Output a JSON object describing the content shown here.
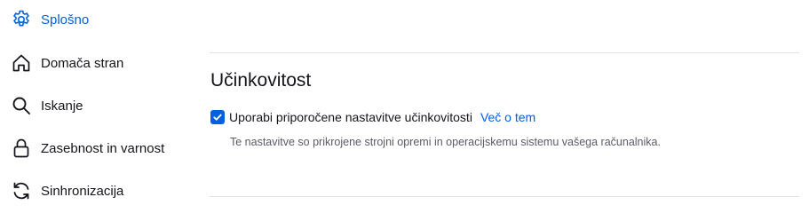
{
  "sidebar": {
    "items": [
      {
        "label": "Splošno",
        "icon": "gear-icon",
        "active": true
      },
      {
        "label": "Domača stran",
        "icon": "home-icon",
        "active": false
      },
      {
        "label": "Iskanje",
        "icon": "search-icon",
        "active": false
      },
      {
        "label": "Zasebnost in varnost",
        "icon": "lock-icon",
        "active": false
      },
      {
        "label": "Sinhronizacija",
        "icon": "sync-icon",
        "active": false
      }
    ]
  },
  "performance": {
    "title": "Učinkovitost",
    "checkbox_label": "Uporabi priporočene nastavitve učinkovitosti",
    "checkbox_checked": true,
    "learn_more": "Več o tem",
    "description": "Te nastavitve so prikrojene strojni opremi in operacijskemu sistemu vašega računalnika."
  },
  "colors": {
    "accent": "#0061e0",
    "text": "#15141a",
    "muted": "#5b5b66",
    "divider": "#e0e0e6"
  }
}
